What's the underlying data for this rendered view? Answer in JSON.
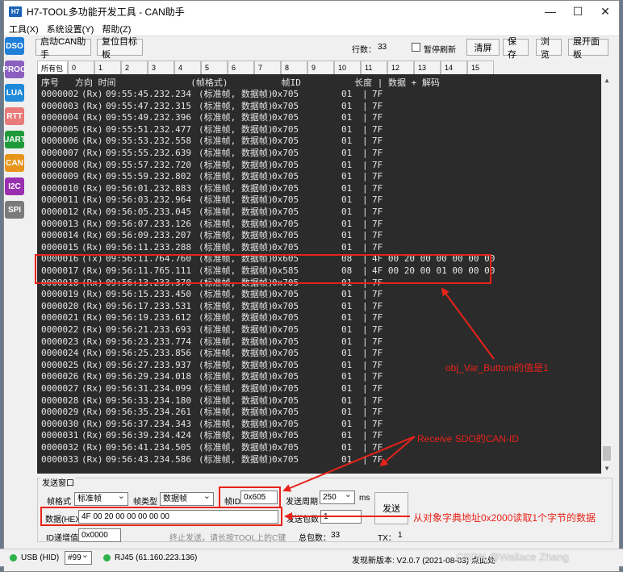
{
  "window": {
    "icon_label": "H7",
    "title": "H7-TOOL多功能开发工具 - CAN助手",
    "minimize": "—",
    "maximize": "☐",
    "close": "✕"
  },
  "menu": [
    "工具(X)",
    "系统设置(Y)",
    "帮助(Z)"
  ],
  "sidebar": [
    {
      "label": "DSO",
      "color": "#1f7fd9"
    },
    {
      "label": "PROG",
      "color": "#8b5fbf"
    },
    {
      "label": "LUA",
      "color": "#1f8ad9"
    },
    {
      "label": "RTT",
      "color": "#e87a7a"
    },
    {
      "label": "UART",
      "color": "#1f9a3a"
    },
    {
      "label": "CAN",
      "color": "#e8931a"
    },
    {
      "label": "I2C",
      "color": "#9a2fb0"
    },
    {
      "label": "SPI",
      "color": "#7a7a7a"
    }
  ],
  "toolbar": {
    "start_can": "启动CAN助手",
    "reset_target": "复位目标板",
    "row_count_label": "行数：",
    "row_count": "33",
    "pause_refresh": "暂停刷新",
    "clear": "清屏",
    "save": "保存",
    "browse": "浏览",
    "expand_panel": "展开面板"
  },
  "tabs": [
    "所有包",
    "0",
    "1",
    "2",
    "3",
    "4",
    "5",
    "6",
    "7",
    "8",
    "9",
    "10",
    "11",
    "12",
    "13",
    "14",
    "15"
  ],
  "console": {
    "header": "序号   方向 时间              (帧格式)          帧ID          长度 | 数据 + 解码",
    "rows": [
      {
        "seq": "0000002",
        "dir": "(Rx)",
        "time": "09:55:45.232.234",
        "fmt": "(标准帧, 数据帧)",
        "id": "0x705",
        "len": "01",
        "data": "7F"
      },
      {
        "seq": "0000003",
        "dir": "(Rx)",
        "time": "09:55:47.232.315",
        "fmt": "(标准帧, 数据帧)",
        "id": "0x705",
        "len": "01",
        "data": "7F"
      },
      {
        "seq": "0000004",
        "dir": "(Rx)",
        "time": "09:55:49.232.396",
        "fmt": "(标准帧, 数据帧)",
        "id": "0x705",
        "len": "01",
        "data": "7F"
      },
      {
        "seq": "0000005",
        "dir": "(Rx)",
        "time": "09:55:51.232.477",
        "fmt": "(标准帧, 数据帧)",
        "id": "0x705",
        "len": "01",
        "data": "7F"
      },
      {
        "seq": "0000006",
        "dir": "(Rx)",
        "time": "09:55:53.232.558",
        "fmt": "(标准帧, 数据帧)",
        "id": "0x705",
        "len": "01",
        "data": "7F"
      },
      {
        "seq": "0000007",
        "dir": "(Rx)",
        "time": "09:55:55.232.639",
        "fmt": "(标准帧, 数据帧)",
        "id": "0x705",
        "len": "01",
        "data": "7F"
      },
      {
        "seq": "0000008",
        "dir": "(Rx)",
        "time": "09:55:57.232.720",
        "fmt": "(标准帧, 数据帧)",
        "id": "0x705",
        "len": "01",
        "data": "7F"
      },
      {
        "seq": "0000009",
        "dir": "(Rx)",
        "time": "09:55:59.232.802",
        "fmt": "(标准帧, 数据帧)",
        "id": "0x705",
        "len": "01",
        "data": "7F"
      },
      {
        "seq": "0000010",
        "dir": "(Rx)",
        "time": "09:56:01.232.883",
        "fmt": "(标准帧, 数据帧)",
        "id": "0x705",
        "len": "01",
        "data": "7F"
      },
      {
        "seq": "0000011",
        "dir": "(Rx)",
        "time": "09:56:03.232.964",
        "fmt": "(标准帧, 数据帧)",
        "id": "0x705",
        "len": "01",
        "data": "7F"
      },
      {
        "seq": "0000012",
        "dir": "(Rx)",
        "time": "09:56:05.233.045",
        "fmt": "(标准帧, 数据帧)",
        "id": "0x705",
        "len": "01",
        "data": "7F"
      },
      {
        "seq": "0000013",
        "dir": "(Rx)",
        "time": "09:56:07.233.126",
        "fmt": "(标准帧, 数据帧)",
        "id": "0x705",
        "len": "01",
        "data": "7F"
      },
      {
        "seq": "0000014",
        "dir": "(Rx)",
        "time": "09:56:09.233.207",
        "fmt": "(标准帧, 数据帧)",
        "id": "0x705",
        "len": "01",
        "data": "7F"
      },
      {
        "seq": "0000015",
        "dir": "(Rx)",
        "time": "09:56:11.233.288",
        "fmt": "(标准帧, 数据帧)",
        "id": "0x705",
        "len": "01",
        "data": "7F"
      },
      {
        "seq": "0000016",
        "dir": "(Tx)",
        "time": "09:56:11.764.760",
        "fmt": "(标准帧, 数据帧)",
        "id": "0x605",
        "len": "08",
        "data": "4F 00 20 00 00 00 00 00"
      },
      {
        "seq": "0000017",
        "dir": "(Rx)",
        "time": "09:56:11.765.111",
        "fmt": "(标准帧, 数据帧)",
        "id": "0x585",
        "len": "08",
        "data": "4F 00 20 00 01 00 00 00"
      },
      {
        "seq": "0000018",
        "dir": "(Rx)",
        "time": "09:56:13.233.370",
        "fmt": "(标准帧, 数据帧)",
        "id": "0x705",
        "len": "01",
        "data": "7F"
      },
      {
        "seq": "0000019",
        "dir": "(Rx)",
        "time": "09:56:15.233.450",
        "fmt": "(标准帧, 数据帧)",
        "id": "0x705",
        "len": "01",
        "data": "7F"
      },
      {
        "seq": "0000020",
        "dir": "(Rx)",
        "time": "09:56:17.233.531",
        "fmt": "(标准帧, 数据帧)",
        "id": "0x705",
        "len": "01",
        "data": "7F"
      },
      {
        "seq": "0000021",
        "dir": "(Rx)",
        "time": "09:56:19.233.612",
        "fmt": "(标准帧, 数据帧)",
        "id": "0x705",
        "len": "01",
        "data": "7F"
      },
      {
        "seq": "0000022",
        "dir": "(Rx)",
        "time": "09:56:21.233.693",
        "fmt": "(标准帧, 数据帧)",
        "id": "0x705",
        "len": "01",
        "data": "7F"
      },
      {
        "seq": "0000023",
        "dir": "(Rx)",
        "time": "09:56:23.233.774",
        "fmt": "(标准帧, 数据帧)",
        "id": "0x705",
        "len": "01",
        "data": "7F"
      },
      {
        "seq": "0000024",
        "dir": "(Rx)",
        "time": "09:56:25.233.856",
        "fmt": "(标准帧, 数据帧)",
        "id": "0x705",
        "len": "01",
        "data": "7F"
      },
      {
        "seq": "0000025",
        "dir": "(Rx)",
        "time": "09:56:27.233.937",
        "fmt": "(标准帧, 数据帧)",
        "id": "0x705",
        "len": "01",
        "data": "7F"
      },
      {
        "seq": "0000026",
        "dir": "(Rx)",
        "time": "09:56:29.234.018",
        "fmt": "(标准帧, 数据帧)",
        "id": "0x705",
        "len": "01",
        "data": "7F"
      },
      {
        "seq": "0000027",
        "dir": "(Rx)",
        "time": "09:56:31.234.099",
        "fmt": "(标准帧, 数据帧)",
        "id": "0x705",
        "len": "01",
        "data": "7F"
      },
      {
        "seq": "0000028",
        "dir": "(Rx)",
        "time": "09:56:33.234.180",
        "fmt": "(标准帧, 数据帧)",
        "id": "0x705",
        "len": "01",
        "data": "7F"
      },
      {
        "seq": "0000029",
        "dir": "(Rx)",
        "time": "09:56:35.234.261",
        "fmt": "(标准帧, 数据帧)",
        "id": "0x705",
        "len": "01",
        "data": "7F"
      },
      {
        "seq": "0000030",
        "dir": "(Rx)",
        "time": "09:56:37.234.343",
        "fmt": "(标准帧, 数据帧)",
        "id": "0x705",
        "len": "01",
        "data": "7F"
      },
      {
        "seq": "0000031",
        "dir": "(Rx)",
        "time": "09:56:39.234.424",
        "fmt": "(标准帧, 数据帧)",
        "id": "0x705",
        "len": "01",
        "data": "7F"
      },
      {
        "seq": "0000032",
        "dir": "(Rx)",
        "time": "09:56:41.234.505",
        "fmt": "(标准帧, 数据帧)",
        "id": "0x705",
        "len": "01",
        "data": "7F"
      },
      {
        "seq": "0000033",
        "dir": "(Rx)",
        "time": "09:56:43.234.586",
        "fmt": "(标准帧, 数据帧)",
        "id": "0x705",
        "len": "01",
        "data": "7F"
      }
    ]
  },
  "send": {
    "group_title": "发送窗口",
    "frame_format_label": "帧格式",
    "frame_format": "标准帧",
    "frame_type_label": "帧类型",
    "frame_type": "数据帧",
    "frame_id_label": "帧ID",
    "frame_id": "0x605",
    "period_label": "发送周期",
    "period": "250",
    "period_unit": "ms",
    "send_button": "发送",
    "data_label": "数据(HEX)",
    "data": "4F 00 20 00 00 00 00 00",
    "count_label": "发送包数",
    "count": "1",
    "id_inc_label": "ID递增值",
    "id_inc": "0x0000",
    "hint": "终止发送，请长按TOOL上的C键",
    "total_label": "总包数：",
    "total": "33",
    "tx_label": "TX：",
    "tx": "1"
  },
  "status": {
    "usb": "USB (HID)",
    "device": "#99",
    "rj45": "RJ45 (61.160.223.136)",
    "version": "发现新版本: V2.0.7 (2021-08-03) 点此处",
    "watermark": "CSDN @Wallace Zhang"
  },
  "annotations": {
    "obj_var": "obj_Var_Buttom的值是1",
    "receive_sdo": "Receive SDO的CAN-ID",
    "read_dict": "从对象字典地址0x2000读取1个字节的数据"
  }
}
